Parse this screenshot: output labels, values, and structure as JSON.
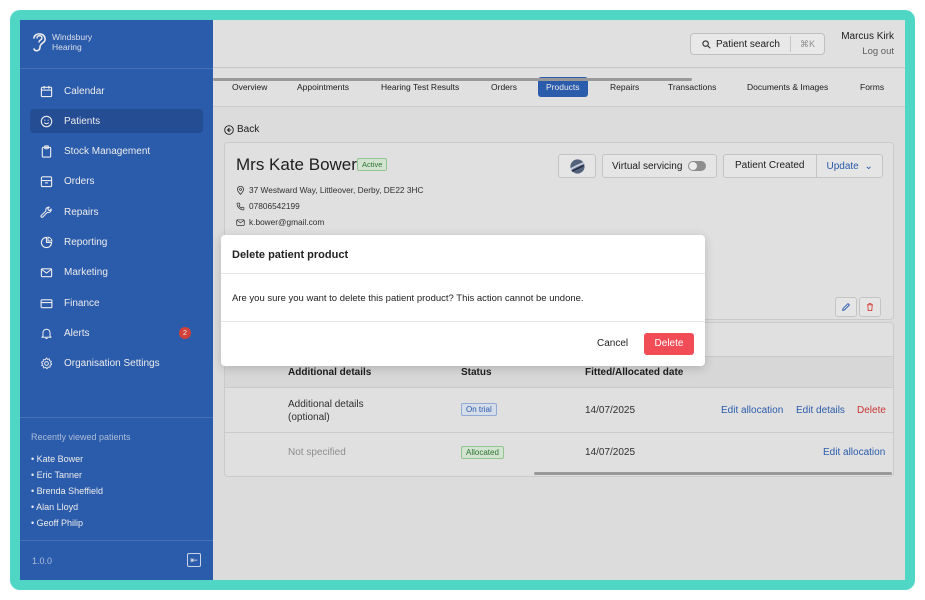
{
  "brand": {
    "line1": "Windsbury",
    "line2": "Hearing"
  },
  "sidebar": {
    "items": [
      {
        "label": "Calendar",
        "icon": "calendar-icon"
      },
      {
        "label": "Patients",
        "icon": "smiley-icon",
        "active": true
      },
      {
        "label": "Stock Management",
        "icon": "clipboard-icon"
      },
      {
        "label": "Orders",
        "icon": "archive-icon"
      },
      {
        "label": "Repairs",
        "icon": "wrench-icon"
      },
      {
        "label": "Reporting",
        "icon": "pie-chart-icon"
      },
      {
        "label": "Marketing",
        "icon": "mail-icon"
      },
      {
        "label": "Finance",
        "icon": "credit-card-icon"
      },
      {
        "label": "Alerts",
        "icon": "bell-icon",
        "badge": "2"
      },
      {
        "label": "Organisation Settings",
        "icon": "gear-icon"
      }
    ],
    "recent_title": "Recently viewed patients",
    "recent": [
      "• Kate Bower",
      "• Eric Tanner",
      "• Brenda Sheffield",
      "• Alan Lloyd",
      "• Geoff Philip"
    ],
    "version": "1.0.0"
  },
  "topbar": {
    "search_label": "Patient search",
    "search_shortcut": "⌘K",
    "user_name": "Marcus Kirk",
    "logout": "Log out"
  },
  "tabs": [
    "Overview",
    "Appointments",
    "Hearing Test Results",
    "Orders",
    "Products",
    "Repairs",
    "Transactions",
    "Documents & Images",
    "Forms"
  ],
  "active_tab": "Products",
  "back_label": "Back",
  "patient": {
    "name": "Mrs Kate Bower",
    "status": "Active",
    "address": "37 Westward Way, Littleover, Derby, DE22 3HC",
    "phone": "07806542199",
    "email": "k.bower@gmail.com"
  },
  "header_actions": {
    "virtual_servicing": "Virtual servicing",
    "virtual_servicing_on": false,
    "patient_created": "Patient Created",
    "update": "Update"
  },
  "table": {
    "headers": [
      "Additional details",
      "Status",
      "Fitted/Allocated date"
    ],
    "rows": [
      {
        "details": "Additional details (optional)",
        "status": "On trial",
        "date": "14/07/2025",
        "actions": [
          "Edit allocation",
          "Edit details",
          "Delete"
        ]
      },
      {
        "details": "Not specified",
        "status": "Allocated",
        "date": "14/07/2025",
        "actions": [
          "Edit allocation"
        ]
      }
    ]
  },
  "modal": {
    "title": "Delete patient product",
    "body": "Are you sure you want to delete this patient product? This action cannot be undone.",
    "cancel": "Cancel",
    "confirm": "Delete"
  },
  "colors": {
    "accent": "#2f63b8",
    "danger": "#f24d57",
    "frame": "#4fd6c5"
  }
}
